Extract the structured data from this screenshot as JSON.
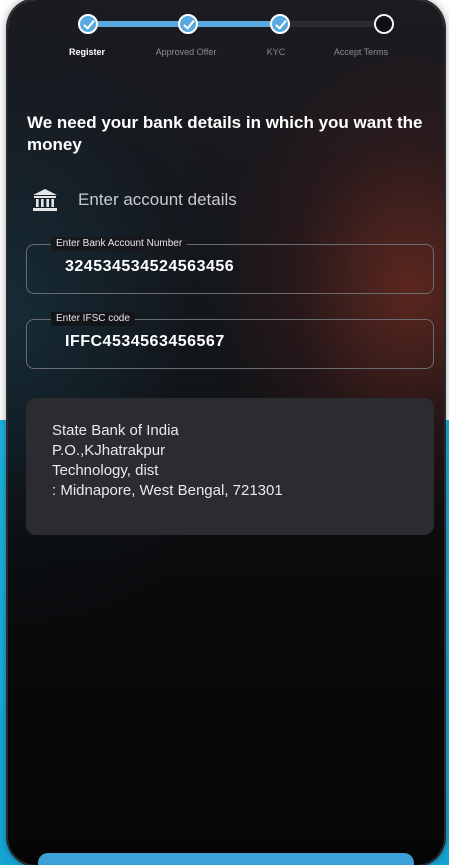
{
  "stepper": {
    "steps": [
      {
        "label": "Register",
        "status": "done",
        "active": true
      },
      {
        "label": "Approved Offer",
        "status": "done",
        "active": false
      },
      {
        "label": "KYC",
        "status": "done",
        "active": false
      },
      {
        "label": "Accept Terms",
        "status": "pending",
        "active": false
      }
    ]
  },
  "heading": "We need your bank details in which you want the money",
  "section": {
    "icon": "bank-icon",
    "title": "Enter account details"
  },
  "fields": {
    "account_number": {
      "label": "Enter Bank Account Number",
      "value": "324534534524563456"
    },
    "ifsc": {
      "label": "Enter IFSC code",
      "value": "IFFC4534563456567"
    }
  },
  "bank_address": {
    "lines": [
      "State Bank of India",
      "P.O.,KJhatrakpur",
      "Technology, dist",
      ": Midnapore, West Bengal, 721301"
    ]
  },
  "colors": {
    "accent": "#58a9e0",
    "background_band": "#1fb3df",
    "card": "#2b2c30"
  }
}
